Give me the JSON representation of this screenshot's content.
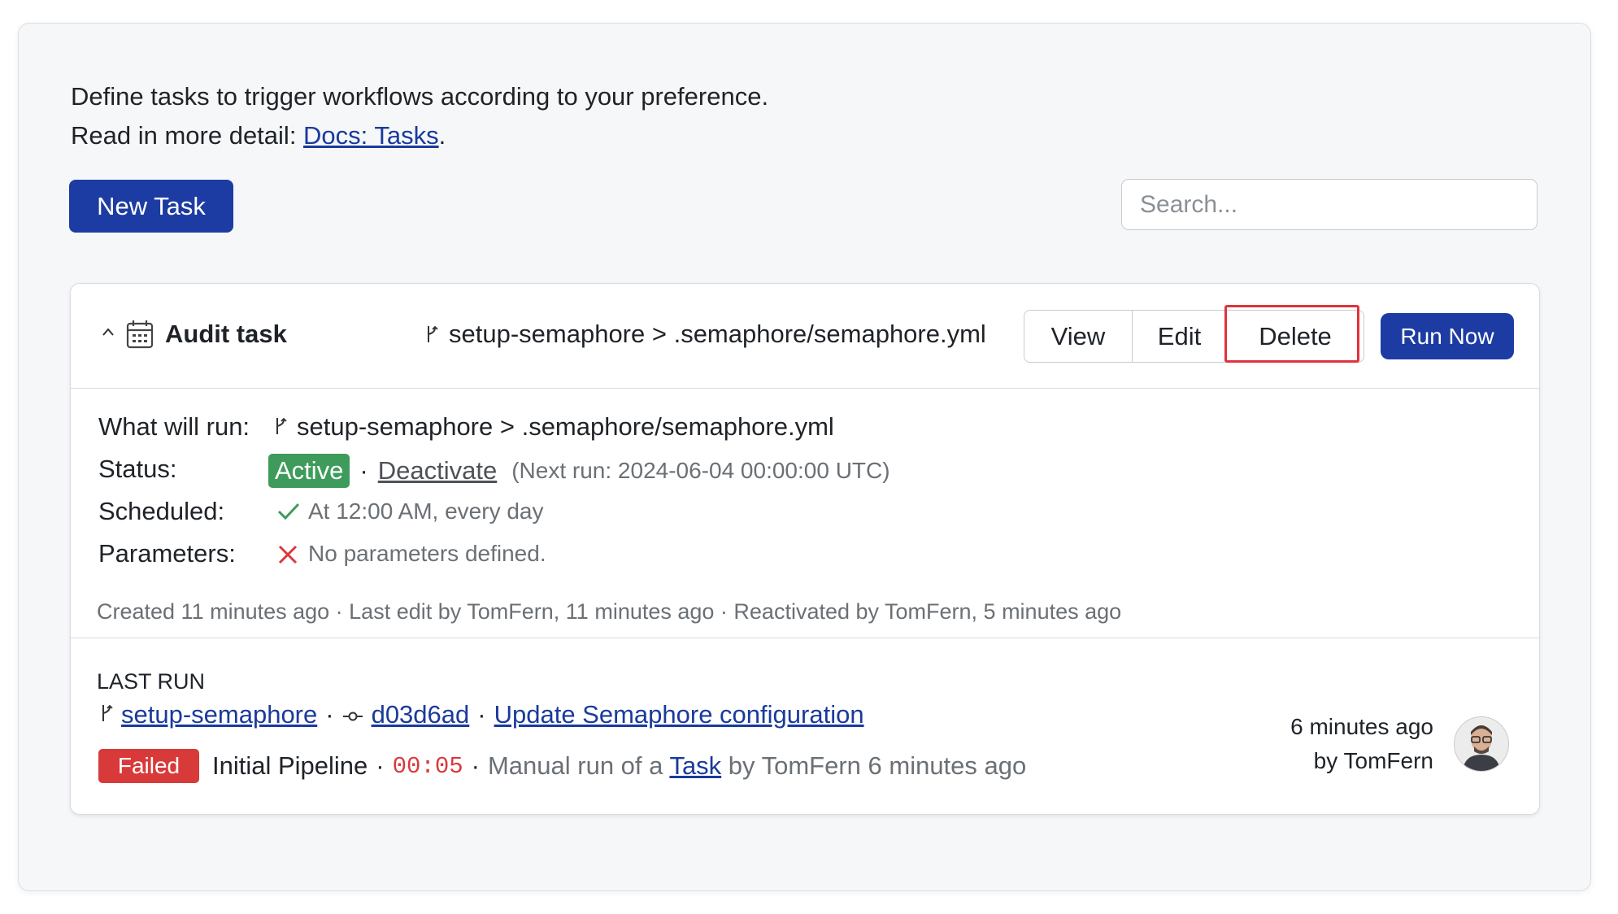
{
  "intro": {
    "line1": "Define tasks to trigger workflows according to your preference.",
    "line2_prefix": "Read in more detail: ",
    "docs_link": "Docs: Tasks",
    "line2_suffix": "."
  },
  "toolbar": {
    "new_task_label": "New Task",
    "search_placeholder": "Search..."
  },
  "task": {
    "name": "Audit task",
    "target": "setup-semaphore > .semaphore/semaphore.yml",
    "actions": {
      "view": "View",
      "edit": "Edit",
      "delete": "Delete",
      "run_now": "Run Now"
    },
    "details": {
      "what_will_run_label": "What will run:",
      "what_will_run_value": "setup-semaphore > .semaphore/semaphore.yml",
      "status_label": "Status:",
      "status_badge": "Active",
      "separator": "·",
      "deactivate_link": "Deactivate",
      "next_run": "(Next run: 2024-06-04 00:00:00 UTC)",
      "scheduled_label": "Scheduled:",
      "scheduled_value": "At 12:00 AM, every day",
      "parameters_label": "Parameters:",
      "parameters_value": "No parameters defined."
    },
    "history": "Created 11 minutes ago · Last edit by TomFern, 11 minutes ago · Reactivated by TomFern, 5 minutes ago",
    "last_run": {
      "heading": "LAST RUN",
      "branch": "setup-semaphore",
      "commit": "d03d6ad",
      "commit_message": "Update Semaphore configuration",
      "status": "Failed",
      "pipeline": "Initial Pipeline",
      "duration": "00:05",
      "trigger_prefix": "Manual run of a ",
      "trigger_link": "Task",
      "trigger_suffix": " by TomFern 6 minutes ago",
      "time_ago": "6 minutes ago",
      "by_user": "by TomFern"
    }
  },
  "colors": {
    "primary": "#1d3ca3",
    "active": "#3f9b5c",
    "failed": "#d83a3a",
    "check": "#3f9b5c",
    "cross": "#d83a3a",
    "highlight": "#e0333a"
  },
  "icons": {
    "collapse": "chevron-up-icon",
    "calendar": "calendar-icon",
    "branch": "branch-icon",
    "commit": "commit-icon",
    "check": "check-icon",
    "cross": "cross-icon"
  }
}
